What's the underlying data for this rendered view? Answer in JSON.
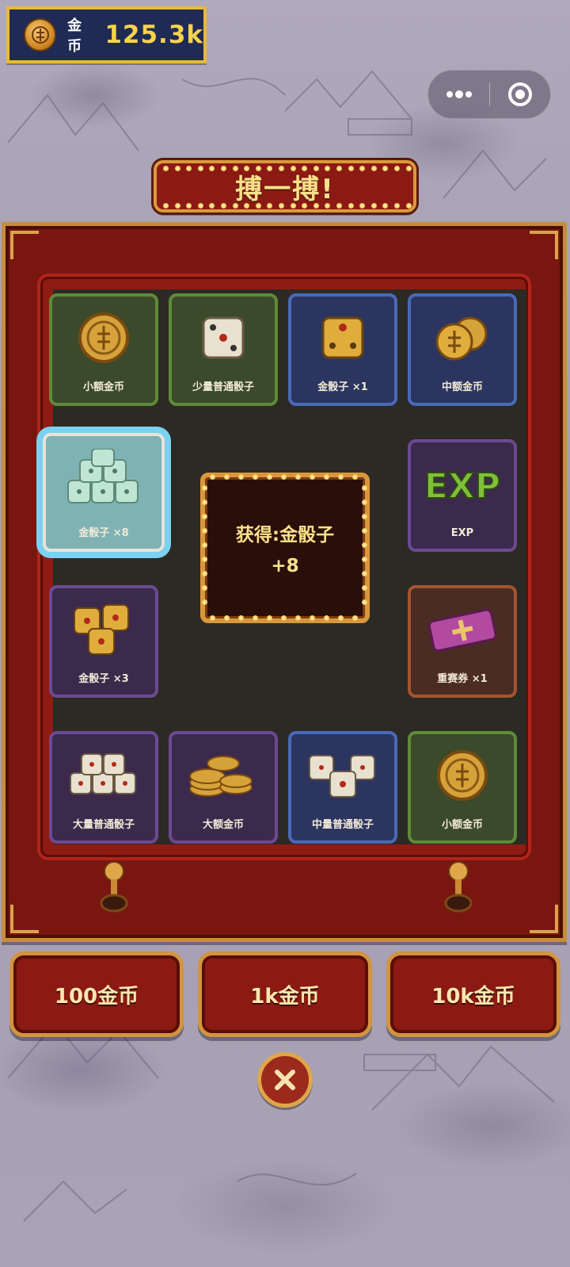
{
  "hud": {
    "coin_label": "金币",
    "coin_value": "125.3k"
  },
  "title": "搏一搏!",
  "tiles": [
    {
      "label": "小额金币",
      "icon": "coin-icon"
    },
    {
      "label": "少量普通骰子",
      "icon": "dice-icon"
    },
    {
      "label": "金骰子 ×1",
      "icon": "gold-dice-icon"
    },
    {
      "label": "中额金币",
      "icon": "coins-icon"
    },
    {
      "label": "金骰子 ×8",
      "icon": "dice-pile-icon"
    },
    {
      "label": "EXP",
      "icon": "exp-icon"
    },
    {
      "label": "金骰子 ×3",
      "icon": "gold-dice-icon"
    },
    {
      "label": "重赛券 ×1",
      "icon": "ticket-icon"
    },
    {
      "label": "大量普通骰子",
      "icon": "dice-pile-icon"
    },
    {
      "label": "大额金币",
      "icon": "coin-stack-icon"
    },
    {
      "label": "中量普通骰子",
      "icon": "dice-icon"
    },
    {
      "label": "小额金币",
      "icon": "coin-icon"
    }
  ],
  "result": {
    "line1": "获得:金骰子",
    "line2": "+8"
  },
  "bets": [
    {
      "label": "100金币"
    },
    {
      "label": "1k金币"
    },
    {
      "label": "10k金币"
    }
  ],
  "colors": {
    "board_red": "#7a1610",
    "gold_trim": "#d29440",
    "selection_highlight": "#7ad1f0"
  }
}
